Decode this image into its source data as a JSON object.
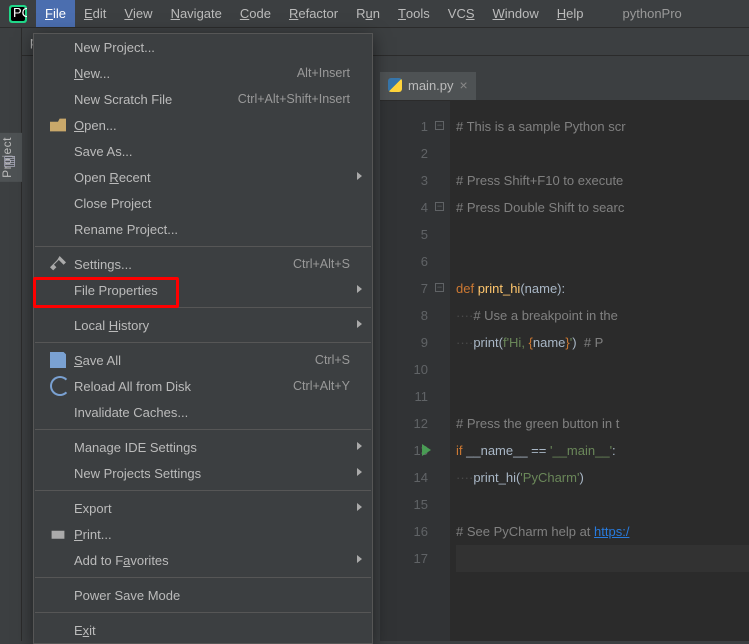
{
  "menubar": {
    "items": [
      {
        "label": "File",
        "mn": "F",
        "active": true
      },
      {
        "label": "Edit",
        "mn": "E"
      },
      {
        "label": "View",
        "mn": "V"
      },
      {
        "label": "Navigate",
        "mn": "N"
      },
      {
        "label": "Code",
        "mn": "C"
      },
      {
        "label": "Refactor",
        "mn": "R"
      },
      {
        "label": "Run",
        "mn": "u",
        "pre": "R"
      },
      {
        "label": "Tools",
        "mn": "T"
      },
      {
        "label": "VCS",
        "mn": "S",
        "pre": "VC"
      },
      {
        "label": "Window",
        "mn": "W"
      },
      {
        "label": "Help",
        "mn": "H"
      }
    ],
    "project_label": "pythonPro"
  },
  "left_tool": {
    "label": "Project"
  },
  "breadcrumb": {
    "text": "pyt"
  },
  "dropdown": {
    "sections": [
      [
        {
          "label": "New Project..."
        },
        {
          "label": "New...",
          "mn": 0,
          "shortcut": "Alt+Insert"
        },
        {
          "label": "New Scratch File",
          "shortcut": "Ctrl+Alt+Shift+Insert"
        },
        {
          "label": "Open...",
          "mn": 0,
          "icon": "ic-open"
        },
        {
          "label": "Save As..."
        },
        {
          "label": "Open Recent",
          "mn": 5,
          "sub": true
        },
        {
          "label": "Close Project"
        },
        {
          "label": "Rename Project..."
        }
      ],
      [
        {
          "label": "Settings...",
          "shortcut": "Ctrl+Alt+S",
          "icon": "ic-wrench"
        },
        {
          "label": "File Properties",
          "sub": true
        }
      ],
      [
        {
          "label": "Local History",
          "mn": 6,
          "sub": true
        }
      ],
      [
        {
          "label": "Save All",
          "mn": 0,
          "shortcut": "Ctrl+S",
          "icon": "ic-save"
        },
        {
          "label": "Reload All from Disk",
          "shortcut": "Ctrl+Alt+Y",
          "icon": "ic-reload"
        },
        {
          "label": "Invalidate Caches..."
        }
      ],
      [
        {
          "label": "Manage IDE Settings",
          "sub": true
        },
        {
          "label": "New Projects Settings",
          "sub": true
        }
      ],
      [
        {
          "label": "Export",
          "sub": true
        },
        {
          "label": "Print...",
          "mn": 0,
          "icon": "ic-print"
        },
        {
          "label": "Add to Favorites",
          "mn": 8,
          "sub": true
        }
      ],
      [
        {
          "label": "Power Save Mode"
        }
      ],
      [
        {
          "label": "Exit",
          "mn": 1
        }
      ]
    ]
  },
  "tab": {
    "filename": "main.py"
  },
  "code": {
    "lines": [
      {
        "n": 1,
        "collapse": true,
        "html": "<span class='c-com'># This is a sample Python scr</span>"
      },
      {
        "n": 2,
        "html": ""
      },
      {
        "n": 3,
        "html": "<span class='c-com'># Press Shift+F10 to execute </span>"
      },
      {
        "n": 4,
        "collapse": true,
        "html": "<span class='c-com'># Press Double Shift to searc</span>"
      },
      {
        "n": 5,
        "html": ""
      },
      {
        "n": 6,
        "html": ""
      },
      {
        "n": 7,
        "collapse": true,
        "html": "<span class='c-kw'>def </span><span class='c-fn'>print_hi</span>(name):"
      },
      {
        "n": 8,
        "html": "<span class='c-ws'>····</span><span class='c-com'># Use a breakpoint in the</span>"
      },
      {
        "n": 9,
        "html": "<span class='c-ws'>····</span>print(<span class='c-str'>f'Hi, </span><span class='c-brace'>{</span>name<span class='c-brace'>}</span><span class='c-str'>'</span>)  <span class='c-com'># P</span>"
      },
      {
        "n": 10,
        "html": ""
      },
      {
        "n": 11,
        "html": ""
      },
      {
        "n": 12,
        "html": "<span class='c-com'># Press the green button in t</span>"
      },
      {
        "n": 13,
        "run": true,
        "html": "<span class='c-kw'>if </span>__name__ == <span class='c-str'>'__main__'</span>:"
      },
      {
        "n": 14,
        "html": "<span class='c-ws'>····</span>print_hi(<span class='c-str'>'PyCharm'</span>)"
      },
      {
        "n": 15,
        "html": ""
      },
      {
        "n": 16,
        "html": "<span class='c-com'># See PyCharm help at </span><span class='c-link'>https:/</span>"
      },
      {
        "n": 17,
        "hl": true,
        "html": ""
      }
    ]
  }
}
